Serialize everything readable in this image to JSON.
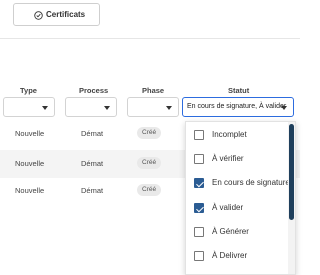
{
  "toolbar": {
    "certificats_label": "Certificats",
    "certificats_icon": "check-circle-icon"
  },
  "table": {
    "headers": {
      "type": "Type",
      "process": "Process",
      "phase": "Phase",
      "statut": "Statut"
    },
    "statut_filter_value": "En cours de signature, À valider",
    "rows": [
      {
        "type": "Nouvelle",
        "process": "Démat",
        "phase": "Créé"
      },
      {
        "type": "Nouvelle",
        "process": "Démat",
        "phase": "Créé"
      },
      {
        "type": "Nouvelle",
        "process": "Démat",
        "phase": "Créé"
      }
    ]
  },
  "statut_dropdown": {
    "options": [
      {
        "label": "Incomplet",
        "checked": false
      },
      {
        "label": "À vérifier",
        "checked": false
      },
      {
        "label": "En cours de signature",
        "checked": true
      },
      {
        "label": "À valider",
        "checked": true
      },
      {
        "label": "À Générer",
        "checked": false
      },
      {
        "label": "À Delivrer",
        "checked": false
      }
    ]
  },
  "colors": {
    "accent": "#2d6cdf",
    "checkbox_checked": "#2b5c93",
    "scrollbar": "#1f3f5c",
    "row_alt": "#f4f4f4"
  }
}
